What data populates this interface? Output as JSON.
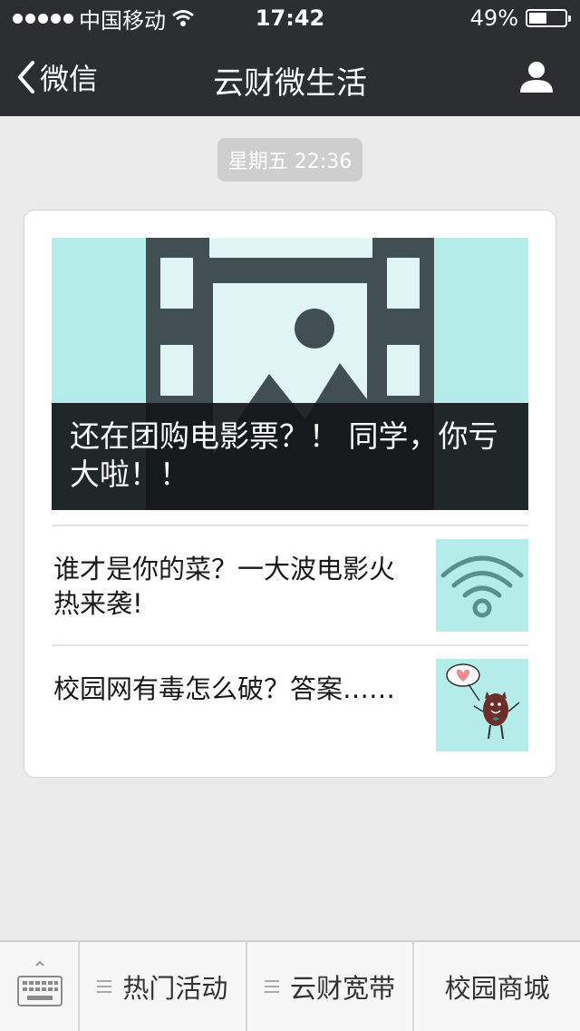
{
  "status_bar": {
    "carrier": "中国移动",
    "time": "17:42",
    "battery_percent": "49%",
    "battery_level": 0.49
  },
  "nav": {
    "back_label": "微信",
    "title": "云财微生活"
  },
  "chat": {
    "timestamp": "星期五 22:36"
  },
  "news_card": {
    "main_title": "还在团购电影票？！ 同学，你亏大啦！！",
    "articles": [
      {
        "title": "谁才是你的菜？一大波电影火热来袭!",
        "thumb_icon": "wifi-icon"
      },
      {
        "title": "校园网有毒怎么破？答案……",
        "thumb_icon": "monster-heart-icon"
      }
    ]
  },
  "bottom_menu": {
    "items": [
      {
        "label": "热门活动",
        "has_submenu": true
      },
      {
        "label": "云财宽带",
        "has_submenu": true
      },
      {
        "label": "校园商城",
        "has_submenu": false
      }
    ]
  },
  "colors": {
    "nav_bg": "#2d2e31",
    "page_bg": "#ebebeb",
    "placeholder_teal": "#b4ecea"
  }
}
